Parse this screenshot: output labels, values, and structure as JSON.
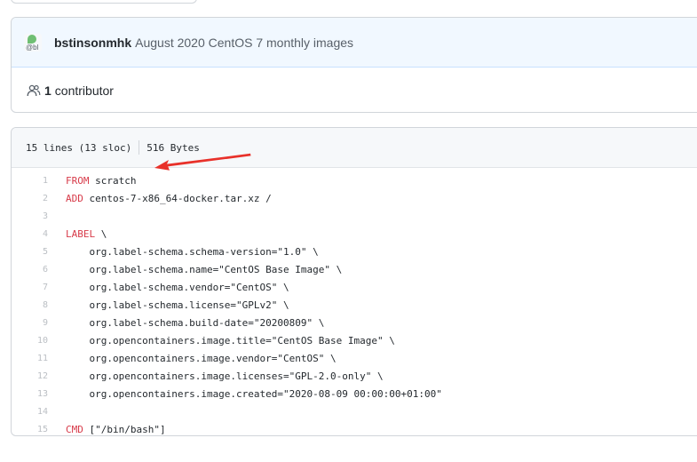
{
  "commit": {
    "author": "bstinsonmhk",
    "message": "August 2020 CentOS 7 monthly images",
    "avatar_alt": "@bl"
  },
  "contributors": {
    "count": "1",
    "label": "contributor"
  },
  "file": {
    "lines_info": "15 lines (13 sloc)",
    "size": "516 Bytes",
    "lines": [
      {
        "num": "1",
        "kw": "FROM",
        "text": " scratch"
      },
      {
        "num": "2",
        "kw": "ADD",
        "text": " centos-7-x86_64-docker.tar.xz /"
      },
      {
        "num": "3",
        "kw": "",
        "text": ""
      },
      {
        "num": "4",
        "kw": "LABEL",
        "text": " \\"
      },
      {
        "num": "5",
        "kw": "",
        "text": "    org.label-schema.schema-version=\"1.0\" \\"
      },
      {
        "num": "6",
        "kw": "",
        "text": "    org.label-schema.name=\"CentOS Base Image\" \\"
      },
      {
        "num": "7",
        "kw": "",
        "text": "    org.label-schema.vendor=\"CentOS\" \\"
      },
      {
        "num": "8",
        "kw": "",
        "text": "    org.label-schema.license=\"GPLv2\" \\"
      },
      {
        "num": "9",
        "kw": "",
        "text": "    org.label-schema.build-date=\"20200809\" \\"
      },
      {
        "num": "10",
        "kw": "",
        "text": "    org.opencontainers.image.title=\"CentOS Base Image\" \\"
      },
      {
        "num": "11",
        "kw": "",
        "text": "    org.opencontainers.image.vendor=\"CentOS\" \\"
      },
      {
        "num": "12",
        "kw": "",
        "text": "    org.opencontainers.image.licenses=\"GPL-2.0-only\" \\"
      },
      {
        "num": "13",
        "kw": "",
        "text": "    org.opencontainers.image.created=\"2020-08-09 00:00:00+01:00\""
      },
      {
        "num": "14",
        "kw": "",
        "text": ""
      },
      {
        "num": "15",
        "kw": "CMD",
        "text": " [\"/bin/bash\"]"
      }
    ]
  },
  "annotation": {
    "arrow_color": "#e8312a"
  }
}
